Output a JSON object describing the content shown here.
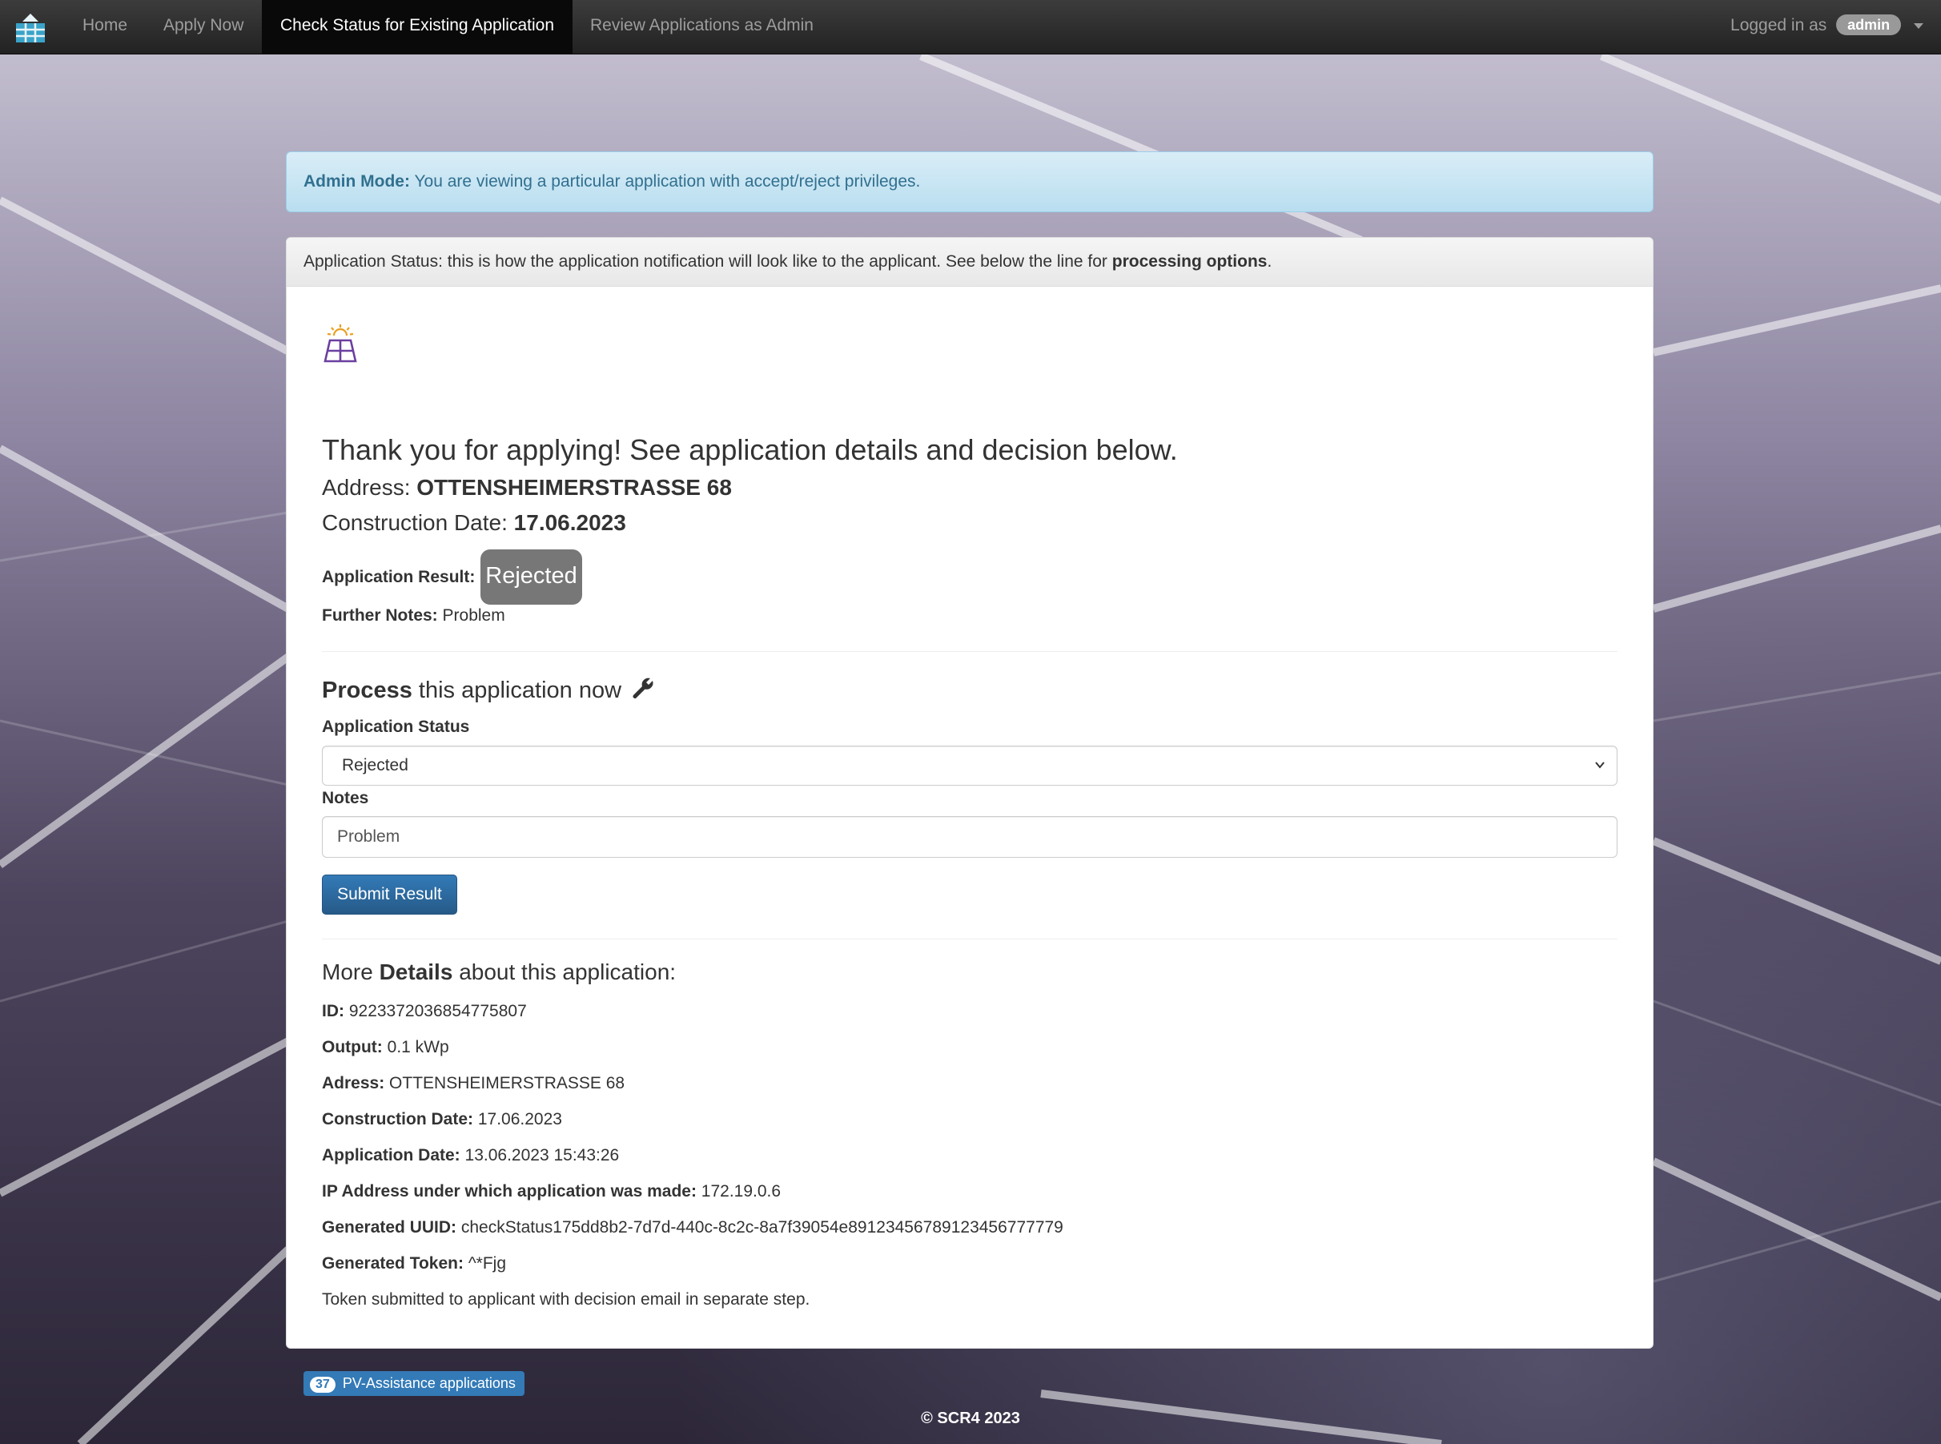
{
  "nav": {
    "items": [
      "Home",
      "Apply Now",
      "Check Status for Existing Application",
      "Review Applications as Admin"
    ],
    "active": "Check Status for Existing Application",
    "logged_in_prefix": "Logged in as",
    "user": "admin"
  },
  "alert": {
    "strong": "Admin Mode:",
    "text": "You are viewing a particular application with accept/reject privileges."
  },
  "panel": {
    "heading_prefix": "Application Status: this is how the application notification will look like to the applicant. See below the line for",
    "heading_bold": "processing options",
    "heading_suffix": "."
  },
  "notification": {
    "thanks": "Thank you for applying! See application details and decision below.",
    "address_label": "Address:",
    "address_value": "OTTENSHEIMERSTRASSE 68",
    "construction_label": "Construction Date:",
    "construction_value": "17.06.2023",
    "result_label": "Application Result:",
    "result_value": "Rejected",
    "notes_label": "Further Notes:",
    "notes_value": "Problem"
  },
  "process": {
    "title_bold": "Process",
    "title_rest": "this application now",
    "status_label": "Application Status",
    "status_selected": "Rejected",
    "notes_label": "Notes",
    "notes_value": "Problem",
    "submit_label": "Submit Result"
  },
  "details": {
    "title_prefix": "More",
    "title_bold": "Details",
    "title_suffix": "about this application:",
    "rows": [
      {
        "label": "ID:",
        "value": "9223372036854775807"
      },
      {
        "label": "Output:",
        "value": "0.1 kWp"
      },
      {
        "label": "Adress:",
        "value": "OTTENSHEIMERSTRASSE 68"
      },
      {
        "label": "Construction Date:",
        "value": "17.06.2023"
      },
      {
        "label": "Application Date:",
        "value": "13.06.2023 15:43:26"
      },
      {
        "label": "IP Address under which application was made:",
        "value": "172.19.0.6"
      },
      {
        "label": "Generated UUID:",
        "value": "checkStatus175dd8b2-7d7d-440c-8c2c-8a7f39054e89123456789123456777779"
      },
      {
        "label": "Generated Token:",
        "value": "^*Fjg"
      }
    ],
    "note": "Token submitted to applicant with decision email in separate step."
  },
  "footer": {
    "count": "37",
    "count_label": "PV-Assistance applications",
    "copyright": "© SCR4 2023"
  },
  "colors": {
    "navbar": "#222222",
    "alert_bg": "#d9edf7",
    "alert_text": "#31708f",
    "primary": "#337ab7",
    "result_badge": "#777777",
    "icon_accent": "#6b3fa0"
  },
  "icons": {
    "brand": "solar-panel-icon",
    "app": "solar-panel-sun-icon",
    "process": "wrench-icon"
  }
}
